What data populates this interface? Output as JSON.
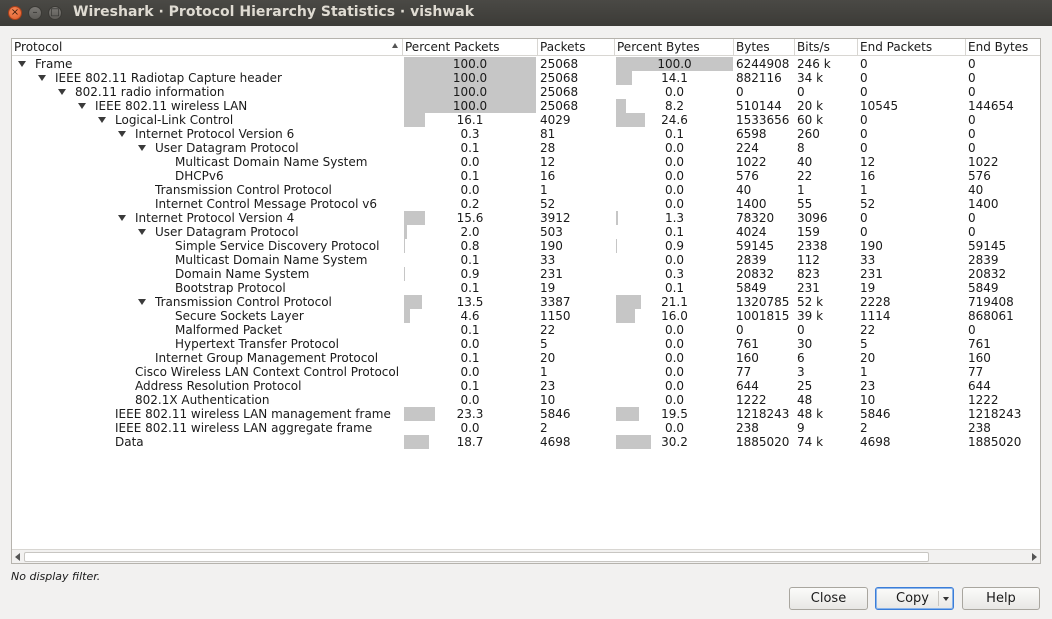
{
  "window": {
    "title": "Wireshark · Protocol Hierarchy Statistics · vishwak",
    "close_glyph": "×",
    "min_glyph": "–",
    "max_glyph": "□"
  },
  "columns": [
    "Protocol",
    "Percent Packets",
    "Packets",
    "Percent Bytes",
    "Bytes",
    "Bits/s",
    "End Packets",
    "End Bytes"
  ],
  "rows": [
    {
      "protocol": "Frame",
      "level": 0,
      "expanded": true,
      "pct_packets": "100.0",
      "packets": "25068",
      "pct_bytes": "100.0",
      "bytes": "6244908",
      "bits": "246 k",
      "end_packets": "0",
      "end_bytes": "0"
    },
    {
      "protocol": "IEEE 802.11 Radiotap Capture header",
      "level": 1,
      "expanded": true,
      "pct_packets": "100.0",
      "packets": "25068",
      "pct_bytes": "14.1",
      "bytes": "882116",
      "bits": "34 k",
      "end_packets": "0",
      "end_bytes": "0"
    },
    {
      "protocol": "802.11 radio information",
      "level": 2,
      "expanded": true,
      "pct_packets": "100.0",
      "packets": "25068",
      "pct_bytes": "0.0",
      "bytes": "0",
      "bits": "0",
      "end_packets": "0",
      "end_bytes": "0"
    },
    {
      "protocol": "IEEE 802.11 wireless LAN",
      "level": 3,
      "expanded": true,
      "pct_packets": "100.0",
      "packets": "25068",
      "pct_bytes": "8.2",
      "bytes": "510144",
      "bits": "20 k",
      "end_packets": "10545",
      "end_bytes": "144654"
    },
    {
      "protocol": "Logical-Link Control",
      "level": 4,
      "expanded": true,
      "pct_packets": "16.1",
      "packets": "4029",
      "pct_bytes": "24.6",
      "bytes": "1533656",
      "bits": "60 k",
      "end_packets": "0",
      "end_bytes": "0"
    },
    {
      "protocol": "Internet Protocol Version 6",
      "level": 5,
      "expanded": true,
      "pct_packets": "0.3",
      "packets": "81",
      "pct_bytes": "0.1",
      "bytes": "6598",
      "bits": "260",
      "end_packets": "0",
      "end_bytes": "0"
    },
    {
      "protocol": "User Datagram Protocol",
      "level": 6,
      "expanded": true,
      "pct_packets": "0.1",
      "packets": "28",
      "pct_bytes": "0.0",
      "bytes": "224",
      "bits": "8",
      "end_packets": "0",
      "end_bytes": "0"
    },
    {
      "protocol": "Multicast Domain Name System",
      "level": 7,
      "expanded": false,
      "pct_packets": "0.0",
      "packets": "12",
      "pct_bytes": "0.0",
      "bytes": "1022",
      "bits": "40",
      "end_packets": "12",
      "end_bytes": "1022"
    },
    {
      "protocol": "DHCPv6",
      "level": 7,
      "expanded": false,
      "pct_packets": "0.1",
      "packets": "16",
      "pct_bytes": "0.0",
      "bytes": "576",
      "bits": "22",
      "end_packets": "16",
      "end_bytes": "576"
    },
    {
      "protocol": "Transmission Control Protocol",
      "level": 6,
      "expanded": false,
      "pct_packets": "0.0",
      "packets": "1",
      "pct_bytes": "0.0",
      "bytes": "40",
      "bits": "1",
      "end_packets": "1",
      "end_bytes": "40"
    },
    {
      "protocol": "Internet Control Message Protocol v6",
      "level": 6,
      "expanded": false,
      "pct_packets": "0.2",
      "packets": "52",
      "pct_bytes": "0.0",
      "bytes": "1400",
      "bits": "55",
      "end_packets": "52",
      "end_bytes": "1400"
    },
    {
      "protocol": "Internet Protocol Version 4",
      "level": 5,
      "expanded": true,
      "pct_packets": "15.6",
      "packets": "3912",
      "pct_bytes": "1.3",
      "bytes": "78320",
      "bits": "3096",
      "end_packets": "0",
      "end_bytes": "0"
    },
    {
      "protocol": "User Datagram Protocol",
      "level": 6,
      "expanded": true,
      "pct_packets": "2.0",
      "packets": "503",
      "pct_bytes": "0.1",
      "bytes": "4024",
      "bits": "159",
      "end_packets": "0",
      "end_bytes": "0"
    },
    {
      "protocol": "Simple Service Discovery Protocol",
      "level": 7,
      "expanded": false,
      "pct_packets": "0.8",
      "packets": "190",
      "pct_bytes": "0.9",
      "bytes": "59145",
      "bits": "2338",
      "end_packets": "190",
      "end_bytes": "59145"
    },
    {
      "protocol": "Multicast Domain Name System",
      "level": 7,
      "expanded": false,
      "pct_packets": "0.1",
      "packets": "33",
      "pct_bytes": "0.0",
      "bytes": "2839",
      "bits": "112",
      "end_packets": "33",
      "end_bytes": "2839"
    },
    {
      "protocol": "Domain Name System",
      "level": 7,
      "expanded": false,
      "pct_packets": "0.9",
      "packets": "231",
      "pct_bytes": "0.3",
      "bytes": "20832",
      "bits": "823",
      "end_packets": "231",
      "end_bytes": "20832"
    },
    {
      "protocol": "Bootstrap Protocol",
      "level": 7,
      "expanded": false,
      "pct_packets": "0.1",
      "packets": "19",
      "pct_bytes": "0.1",
      "bytes": "5849",
      "bits": "231",
      "end_packets": "19",
      "end_bytes": "5849"
    },
    {
      "protocol": "Transmission Control Protocol",
      "level": 6,
      "expanded": true,
      "pct_packets": "13.5",
      "packets": "3387",
      "pct_bytes": "21.1",
      "bytes": "1320785",
      "bits": "52 k",
      "end_packets": "2228",
      "end_bytes": "719408"
    },
    {
      "protocol": "Secure Sockets Layer",
      "level": 7,
      "expanded": false,
      "pct_packets": "4.6",
      "packets": "1150",
      "pct_bytes": "16.0",
      "bytes": "1001815",
      "bits": "39 k",
      "end_packets": "1114",
      "end_bytes": "868061"
    },
    {
      "protocol": "Malformed Packet",
      "level": 7,
      "expanded": false,
      "pct_packets": "0.1",
      "packets": "22",
      "pct_bytes": "0.0",
      "bytes": "0",
      "bits": "0",
      "end_packets": "22",
      "end_bytes": "0"
    },
    {
      "protocol": "Hypertext Transfer Protocol",
      "level": 7,
      "expanded": false,
      "pct_packets": "0.0",
      "packets": "5",
      "pct_bytes": "0.0",
      "bytes": "761",
      "bits": "30",
      "end_packets": "5",
      "end_bytes": "761"
    },
    {
      "protocol": "Internet Group Management Protocol",
      "level": 6,
      "expanded": false,
      "pct_packets": "0.1",
      "packets": "20",
      "pct_bytes": "0.0",
      "bytes": "160",
      "bits": "6",
      "end_packets": "20",
      "end_bytes": "160"
    },
    {
      "protocol": "Cisco Wireless LAN Context Control Protocol",
      "level": 5,
      "expanded": false,
      "pct_packets": "0.0",
      "packets": "1",
      "pct_bytes": "0.0",
      "bytes": "77",
      "bits": "3",
      "end_packets": "1",
      "end_bytes": "77"
    },
    {
      "protocol": "Address Resolution Protocol",
      "level": 5,
      "expanded": false,
      "pct_packets": "0.1",
      "packets": "23",
      "pct_bytes": "0.0",
      "bytes": "644",
      "bits": "25",
      "end_packets": "23",
      "end_bytes": "644"
    },
    {
      "protocol": "802.1X Authentication",
      "level": 5,
      "expanded": false,
      "pct_packets": "0.0",
      "packets": "10",
      "pct_bytes": "0.0",
      "bytes": "1222",
      "bits": "48",
      "end_packets": "10",
      "end_bytes": "1222"
    },
    {
      "protocol": "IEEE 802.11 wireless LAN management frame",
      "level": 4,
      "expanded": false,
      "pct_packets": "23.3",
      "packets": "5846",
      "pct_bytes": "19.5",
      "bytes": "1218243",
      "bits": "48 k",
      "end_packets": "5846",
      "end_bytes": "1218243"
    },
    {
      "protocol": "IEEE 802.11 wireless LAN aggregate frame",
      "level": 4,
      "expanded": false,
      "pct_packets": "0.0",
      "packets": "2",
      "pct_bytes": "0.0",
      "bytes": "238",
      "bits": "9",
      "end_packets": "2",
      "end_bytes": "238"
    },
    {
      "protocol": "Data",
      "level": 4,
      "expanded": false,
      "pct_packets": "18.7",
      "packets": "4698",
      "pct_bytes": "30.2",
      "bytes": "1885020",
      "bits": "74 k",
      "end_packets": "4698",
      "end_bytes": "1885020"
    }
  ],
  "status": "No display filter.",
  "buttons": {
    "close": "Close",
    "copy": "Copy",
    "help": "Help"
  },
  "colors": {
    "bar": "#c6c6c6",
    "focus": "#3b7dd8"
  }
}
